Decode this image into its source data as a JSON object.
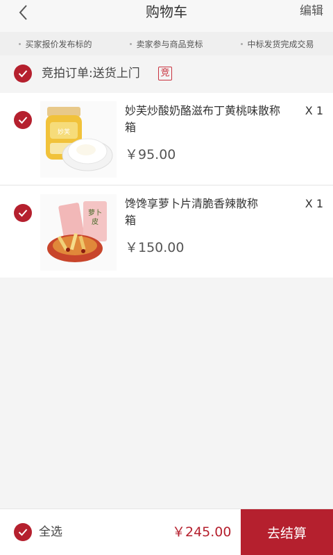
{
  "header": {
    "title": "购物车",
    "edit_label": "编辑",
    "back_icon": "chevron-left-icon"
  },
  "steps": [
    "买家报价发布标的",
    "卖家参与商品竞标",
    "中标发货完成交易"
  ],
  "group": {
    "label": "竞拍订单:送货上门",
    "badge": "竞",
    "checked": true
  },
  "items": [
    {
      "name": "妙芙炒酸奶酪滋布丁黄桃味散称",
      "qty": "X 1",
      "unit": "箱",
      "price": "￥95.00",
      "checked": true,
      "image": "yogurt-pudding-product-image"
    },
    {
      "name": "馋馋享萝卜片清脆香辣散称",
      "qty": "X 1",
      "unit": "箱",
      "price": "￥150.00",
      "checked": true,
      "image": "spicy-radish-product-image"
    }
  ],
  "footer": {
    "select_all_label": "全选",
    "total": "￥245.00",
    "checkout_label": "去结算",
    "accent_color": "#b5202e"
  }
}
